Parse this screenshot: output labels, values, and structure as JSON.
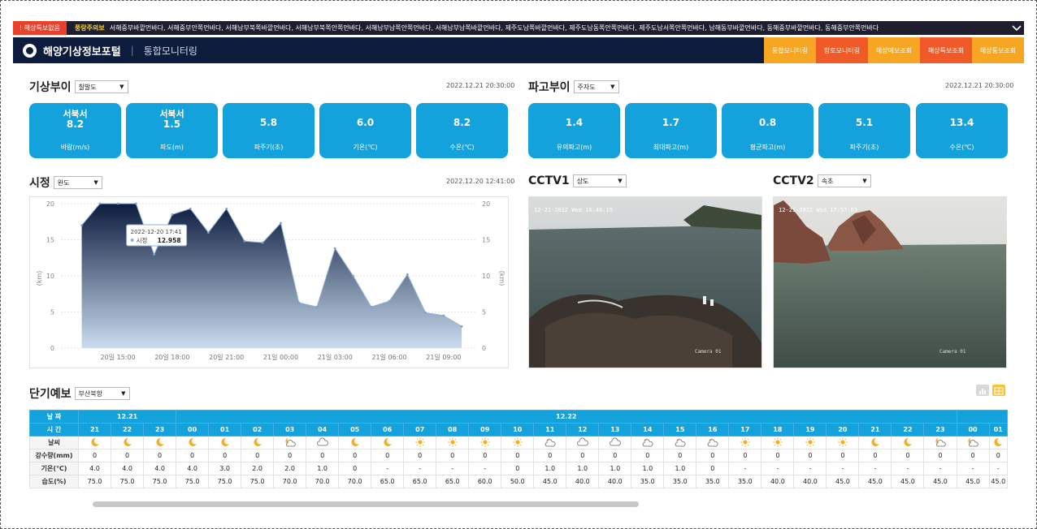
{
  "alert": {
    "badge": "! 해상특보없음",
    "warning": "풍랑주의보",
    "ticker": "서해중부바깥먼바다, 서해중부안쪽먼바다, 서해남부북쪽바깥먼바다, 서해남부북쪽안쪽먼바다, 서해남부남쪽안쪽먼바다, 서해남부남쪽바깥먼바다, 제주도남쪽바깥먼바다, 제주도남동쪽안쪽먼바다, 제주도남서쪽안쪽먼바다, 남해동부바깥먼바다, 동해중부바깥먼바다, 동해중부안쪽먼바다"
  },
  "header": {
    "title": "해양기상정보포털",
    "subtitle": "통합모니터링",
    "tabs": [
      {
        "label": "통합모니터링",
        "color": "#f6a623"
      },
      {
        "label": "항로모니터링",
        "color": "#f05a28"
      },
      {
        "label": "해상예보조회",
        "color": "#f6a623"
      },
      {
        "label": "해상특보조회",
        "color": "#f05a28"
      },
      {
        "label": "해상통보조회",
        "color": "#f6a623"
      }
    ]
  },
  "weather_buoy": {
    "title": "기상부이",
    "select": "칠발도",
    "timestamp": "2022.12.21 20:30:00",
    "cards": [
      {
        "name": "서북서",
        "value": "8.2",
        "label": "바람(m/s)"
      },
      {
        "name": "서북서",
        "value": "1.5",
        "label": "파도(m)"
      },
      {
        "name": "",
        "value": "5.8",
        "label": "파주기(초)"
      },
      {
        "name": "",
        "value": "6.0",
        "label": "기온(℃)"
      },
      {
        "name": "",
        "value": "8.2",
        "label": "수온(℃)"
      }
    ]
  },
  "wave_buoy": {
    "title": "파고부이",
    "select": "주자도",
    "timestamp": "2022.12.21 20:30:00",
    "cards": [
      {
        "value": "1.4",
        "label": "유의파고(m)"
      },
      {
        "value": "1.7",
        "label": "최대파고(m)"
      },
      {
        "value": "0.8",
        "label": "평균파고(m)"
      },
      {
        "value": "5.1",
        "label": "파주기(초)"
      },
      {
        "value": "13.4",
        "label": "수온(℃)"
      }
    ]
  },
  "visibility": {
    "title": "시정",
    "select": "완도",
    "timestamp": "2022.12.20 12:41:00",
    "tooltip": {
      "time": "2022-12-20 17:41",
      "series": "시정",
      "value": "12.958"
    }
  },
  "chart_data": {
    "type": "area",
    "ylabel": "(km)",
    "ylabel_right": "(km)",
    "ylim": [
      0,
      20
    ],
    "yticks": [
      "0",
      "5",
      "10",
      "15",
      "20"
    ],
    "xticks": [
      "20일 15:00",
      "20일 18:00",
      "20일 21:00",
      "21일 00:00",
      "21일 03:00",
      "21일 06:00",
      "21일 09:00"
    ],
    "x_hours": [
      13,
      14,
      15,
      16,
      17,
      18,
      19,
      20,
      21,
      22,
      23,
      24,
      25,
      26,
      27,
      28,
      29,
      30,
      31,
      32,
      33,
      34
    ],
    "values": [
      17,
      20,
      20,
      20,
      12.958,
      18.5,
      19.3,
      16,
      19.3,
      14.8,
      14.6,
      17.3,
      6.3,
      5.7,
      13.8,
      10,
      5.7,
      6.5,
      10.2,
      4.9,
      4.5,
      3
    ],
    "fill_top": "#0d1b3d",
    "fill_bottom": "#c9dcef"
  },
  "cctv1": {
    "title": "CCTV1",
    "select": "상도",
    "overlay": "12-21-2022 Wed 16:46:19",
    "camera": "Camera 01"
  },
  "cctv2": {
    "title": "CCTV2",
    "select": "속초",
    "overlay": "12-21-2022 Wed 17:57:03",
    "camera": "Camera 01"
  },
  "forecast": {
    "title": "단기예보",
    "select": "부산북항",
    "row_labels": [
      "날 짜",
      "시 간",
      "날씨",
      "강수량(mm)",
      "기온(℃)",
      "습도(%)"
    ],
    "date1": "12.21",
    "date2": "12.22",
    "hours": [
      "21",
      "22",
      "23",
      "00",
      "01",
      "02",
      "03",
      "04",
      "05",
      "06",
      "07",
      "08",
      "09",
      "10",
      "11",
      "12",
      "13",
      "14",
      "15",
      "16",
      "17",
      "18",
      "19",
      "20",
      "21",
      "22",
      "23",
      "00",
      "01"
    ],
    "weather_icons": [
      "moon",
      "moon",
      "moon",
      "moon",
      "moon",
      "moon",
      "moon-cloud",
      "cloud",
      "moon",
      "moon",
      "sun",
      "sun",
      "sun",
      "sun",
      "sun-cloud",
      "cloud",
      "cloud",
      "sun-cloud",
      "sun-cloud",
      "sun-cloud",
      "sun",
      "sun",
      "sun",
      "sun",
      "moon",
      "moon",
      "moon-cloud",
      "moon-cloud",
      "moon"
    ],
    "precip": [
      "0",
      "0",
      "0",
      "0",
      "0",
      "0",
      "0",
      "0",
      "0",
      "0",
      "0",
      "0",
      "0",
      "0",
      "0",
      "0",
      "0",
      "0",
      "0",
      "0",
      "0",
      "0",
      "0",
      "0",
      "0",
      "0",
      "0",
      "0",
      "0"
    ],
    "temp": [
      "4.0",
      "4.0",
      "4.0",
      "4.0",
      "3.0",
      "2.0",
      "2.0",
      "1.0",
      "0",
      "-",
      "-",
      "-",
      "-",
      "0",
      "1.0",
      "1.0",
      "1.0",
      "1.0",
      "1.0",
      "0",
      "-",
      "-",
      "-",
      "-",
      "-",
      "-",
      "-",
      "-",
      "-"
    ],
    "humidity": [
      "75.0",
      "75.0",
      "75.0",
      "75.0",
      "75.0",
      "75.0",
      "70.0",
      "70.0",
      "70.0",
      "65.0",
      "65.0",
      "65.0",
      "60.0",
      "50.0",
      "45.0",
      "40.0",
      "40.0",
      "35.0",
      "35.0",
      "35.0",
      "35.0",
      "40.0",
      "40.0",
      "45.0",
      "45.0",
      "45.0",
      "45.0",
      "45.0",
      "45.0"
    ]
  }
}
